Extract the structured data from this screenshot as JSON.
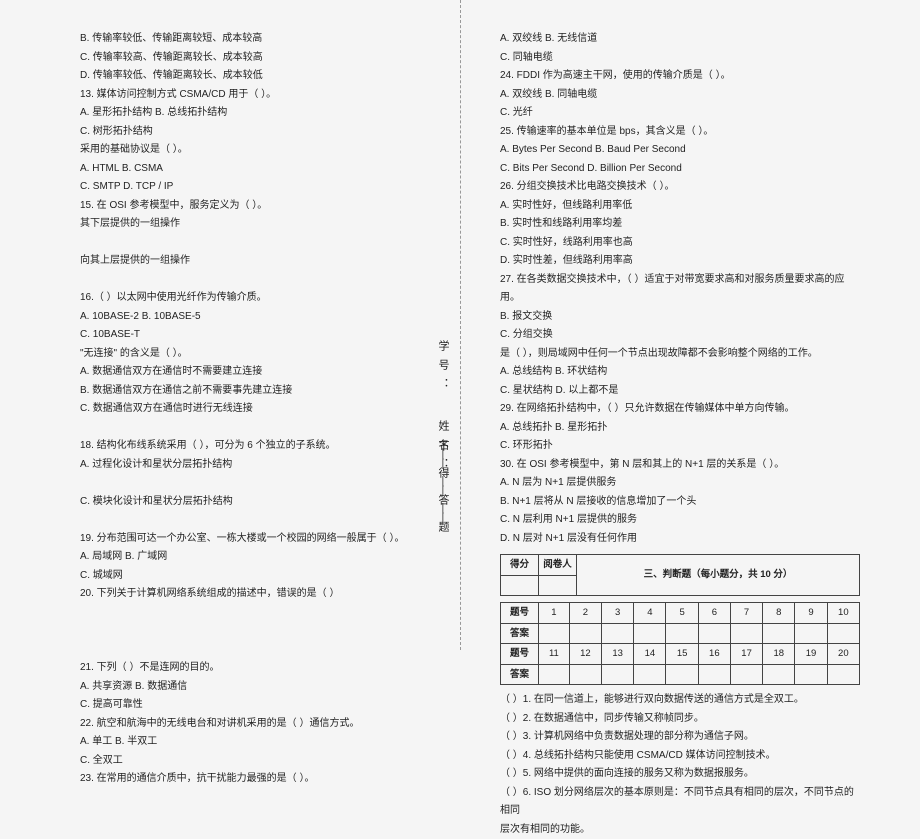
{
  "left": {
    "lines": [
      "B. 传输率较低、传输距离较短、成本较高",
      "C. 传输率较高、传输距离较长、成本较高",
      "D. 传输率较低、传输距离较长、成本较低",
      "13. 媒体访问控制方式 CSMA/CD 用于（    ）。",
      "A. 星形拓扑结构                              B. 总线拓扑结构",
      "C. 树形拓扑结构",
      "采用的基础协议是（    ）。",
      "A. HTML                                                     B. CSMA",
      "C. SMTP                                                     D. TCP / IP",
      "15. 在 OSI 参考模型中，服务定义为（    ）。",
      "    其下层提供的一组操作",
      "",
      "    向其上层提供的一组操作",
      "",
      "16.（    ）以太网中使用光纤作为传输介质。",
      "A. 10BASE-2                                        B. 10BASE-5",
      "C. 10BASE-T",
      "\"无连接\" 的含义是（    ）。",
      "A. 数据通信双方在通信时不需要建立连接",
      "B. 数据通信双方在通信之前不需要事先建立连接",
      "C. 数据通信双方在通信时进行无线连接",
      "",
      "18. 结构化布线系统采用（    ），可分为 6 个独立的子系统。",
      "A. 过程化设计和星状分层拓扑结构",
      "",
      "C. 模块化设计和星状分层拓扑结构",
      "",
      "19. 分布范围可达一个办公室、一栋大楼或一个校园的网络一般属于（     ）。",
      "A. 局域网                                         B. 广域网",
      "C. 城域网",
      "20. 下列关于计算机网络系统组成的描述中，错误的是（    ）",
      "",
      "",
      "",
      "21. 下列（    ）不是连网的目的。",
      "A. 共享资源                                         B. 数据通信",
      "C. 提高可靠性",
      "22. 航空和航海中的无线电台和对讲机采用的是（     ）通信方式。",
      "A. 单工                                                 B. 半双工",
      "C. 全双工",
      "23. 在常用的通信介质中，抗干扰能力最强的是（    ）。"
    ]
  },
  "right": {
    "lines_top": [
      "A. 双绞线                                         B. 无线信道",
      "C. 同轴电缆",
      "24. FDDI 作为高速主干网，使用的传输介质是（    ）。",
      "A. 双绞线                                         B. 同轴电缆",
      "C. 光纤",
      "25. 传输速率的基本单位是 bps，其含义是（    ）。",
      "A. Bytes Per Second                    B. Baud Per Second",
      "C. Bits Per Second                      D. Billion Per Second",
      "26. 分组交换技术比电路交换技术（    ）。",
      "A. 实时性好，但线路利用率低",
      "B. 实时性和线路利用率均差",
      "C. 实时性好，线路利用率也高",
      "D. 实时性差，但线路利用率高",
      "27. 在各类数据交换技术中，（    ）适宜于对带宽要求高和对服务质量要求高的应用。",
      "                                             B. 报文交换",
      "C. 分组交换",
      "是（    ），则局域网中任何一个节点出现故障都不会影响整个网络的工作。",
      "A. 总线结构                                    B. 环状结构",
      "C. 星状结构                                    D. 以上都不是",
      "29. 在网络拓扑结构中，（    ）只允许数据在传输媒体中单方向传输。",
      "A. 总线拓扑                                    B. 星形拓扑",
      "C. 环形拓扑",
      "30. 在 OSI 参考模型中，第 N 层和其上的 N+1 层的关系是（    ）。",
      "A. N 层为 N+1 层提供服务",
      "B. N+1 层将从 N 层接收的信息增加了一个头",
      "C. N 层利用 N+1 层提供的服务",
      "D. N 层对 N+1 层没有任何作用"
    ],
    "section3": {
      "score_labels": {
        "score": "得分",
        "reviewer": "阅卷人"
      },
      "title": "三、判断题（每小题分，共 10 分）",
      "grid": {
        "row_num_label": "题号",
        "row_ans_label": "答案",
        "nums_top": [
          "1",
          "2",
          "3",
          "4",
          "5",
          "6",
          "7",
          "8",
          "9",
          "10"
        ],
        "nums_bottom": [
          "11",
          "12",
          "13",
          "14",
          "15",
          "16",
          "17",
          "18",
          "19",
          "20"
        ]
      }
    },
    "judge_lines": [
      "（     ）1. 在同一信道上，能够进行双向数据传送的通信方式是全双工。",
      "（     ）2. 在数据通信中，同步传输又称帧同步。",
      "（     ）3. 计算机网络中负责数据处理的部分称为通信子网。",
      "（     ）4. 总线拓扑结构只能使用 CSMA/CD 媒体访问控制技术。",
      "（     ）5. 网络中提供的面向连接的服务又称为数据报服务。",
      "（     ）6. ISO 划分网络层次的基本原则是：不同节点具有相同的层次，不同节点的相同",
      "层次有相同的功能。"
    ]
  },
  "vertical": {
    "v1": "学号：",
    "v2": "姓名：",
    "v3": "下——得——答——题"
  }
}
